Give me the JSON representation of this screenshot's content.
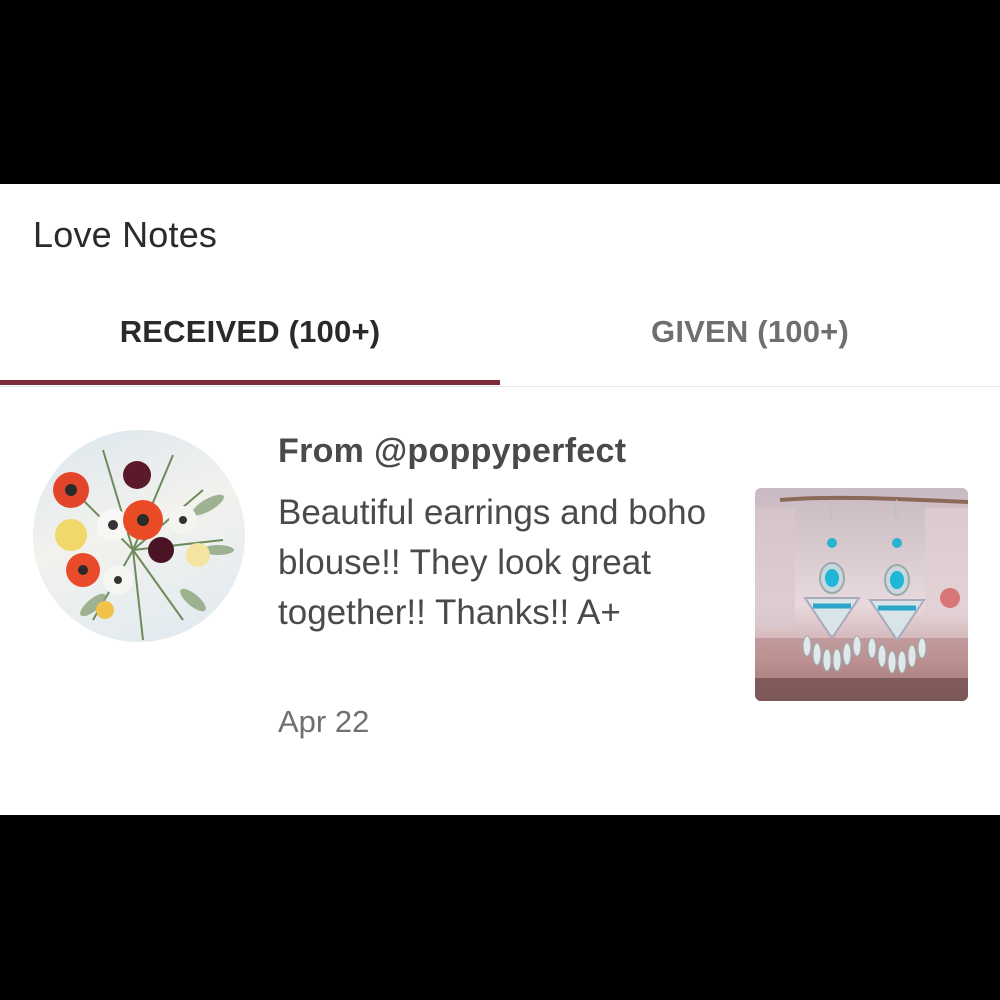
{
  "header": {
    "title": "Love Notes"
  },
  "tabs": [
    {
      "label": "RECEIVED (100+)",
      "active": true
    },
    {
      "label": "GIVEN (100+)",
      "active": false
    }
  ],
  "colors": {
    "accent": "#7f2a38",
    "text_primary": "#2b2b2b",
    "text_secondary": "#4a4a4a",
    "text_muted": "#707070"
  },
  "note": {
    "from": "From @poppyperfect",
    "message": "Beautiful earrings and boho blouse!! They look great together!! Thanks!! A+",
    "date": "Apr 22",
    "avatar_icon": "flower-bouquet-avatar",
    "product_icon": "earrings-product-photo"
  }
}
